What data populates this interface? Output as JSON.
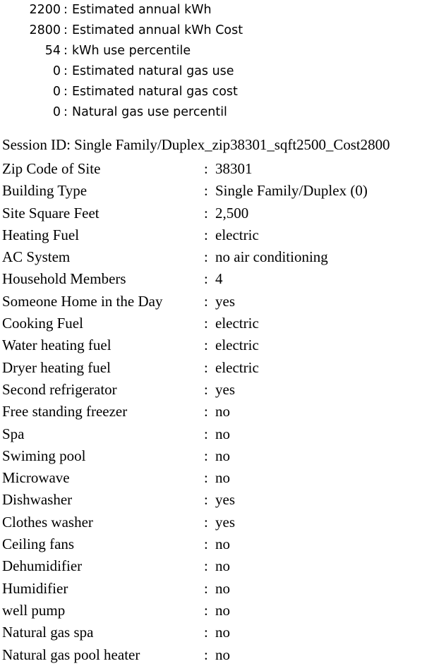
{
  "summary": {
    "separator": ":",
    "rows": [
      {
        "value": "2200",
        "label": "Estimated annual kWh"
      },
      {
        "value": "2800",
        "label": "Estimated annual kWh Cost"
      },
      {
        "value": "54",
        "label": "kWh use percentile"
      },
      {
        "value": "0",
        "label": "Estimated natural gas use"
      },
      {
        "value": "0",
        "label": "Estimated natural gas cost"
      },
      {
        "value": "0",
        "label": "Natural gas use percentil"
      }
    ]
  },
  "session": {
    "line": "Session ID: Single Family/Duplex_zip38301_sqft2500_Cost2800"
  },
  "details": {
    "separator": ":",
    "rows": [
      {
        "label": "Zip Code of Site",
        "value": "38301"
      },
      {
        "label": "Building Type",
        "value": "Single Family/Duplex (0)"
      },
      {
        "label": "Site Square Feet",
        "value": "2,500"
      },
      {
        "label": "Heating Fuel",
        "value": "electric"
      },
      {
        "label": "AC System",
        "value": "no air conditioning"
      },
      {
        "label": "Household Members",
        "value": "4"
      },
      {
        "label": "Someone Home in the Day",
        "value": "yes"
      },
      {
        "label": "Cooking Fuel",
        "value": "electric"
      },
      {
        "label": "Water heating fuel",
        "value": "electric"
      },
      {
        "label": "Dryer heating fuel",
        "value": "electric"
      },
      {
        "label": "Second refrigerator",
        "value": "yes"
      },
      {
        "label": "Free standing freezer",
        "value": "no"
      },
      {
        "label": "Spa",
        "value": "no"
      },
      {
        "label": "Swiming pool",
        "value": "no"
      },
      {
        "label": "Microwave",
        "value": "no"
      },
      {
        "label": "Dishwasher",
        "value": "yes"
      },
      {
        "label": "Clothes washer",
        "value": "yes"
      },
      {
        "label": "Ceiling fans",
        "value": "no"
      },
      {
        "label": "Dehumidifier",
        "value": "no"
      },
      {
        "label": "Humidifier",
        "value": "no"
      },
      {
        "label": "well pump",
        "value": "no"
      },
      {
        "label": "Natural gas spa",
        "value": "no"
      },
      {
        "label": "Natural gas pool heater",
        "value": "no"
      }
    ]
  },
  "colors": {
    "background": "#ffffff",
    "text": "#000000"
  }
}
